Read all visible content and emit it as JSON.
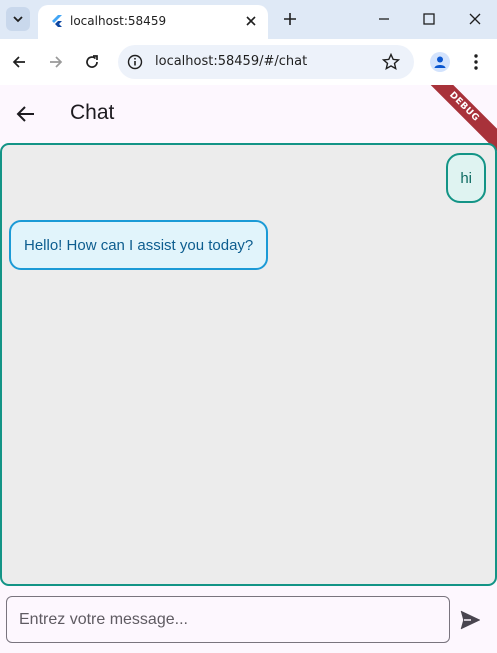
{
  "browser": {
    "tab_title": "localhost:58459",
    "url": "localhost:58459/#/chat"
  },
  "app": {
    "title": "Chat",
    "debug_banner": "DEBUG"
  },
  "chat": {
    "messages": [
      {
        "sender": "user",
        "text": "hi"
      },
      {
        "sender": "bot",
        "text": "Hello! How can I assist you today?"
      }
    ]
  },
  "input": {
    "placeholder": "Entrez votre message...",
    "value": ""
  },
  "colors": {
    "accent_teal": "#139486",
    "bot_border": "#1b9ad6",
    "chat_bg": "#ececec"
  }
}
